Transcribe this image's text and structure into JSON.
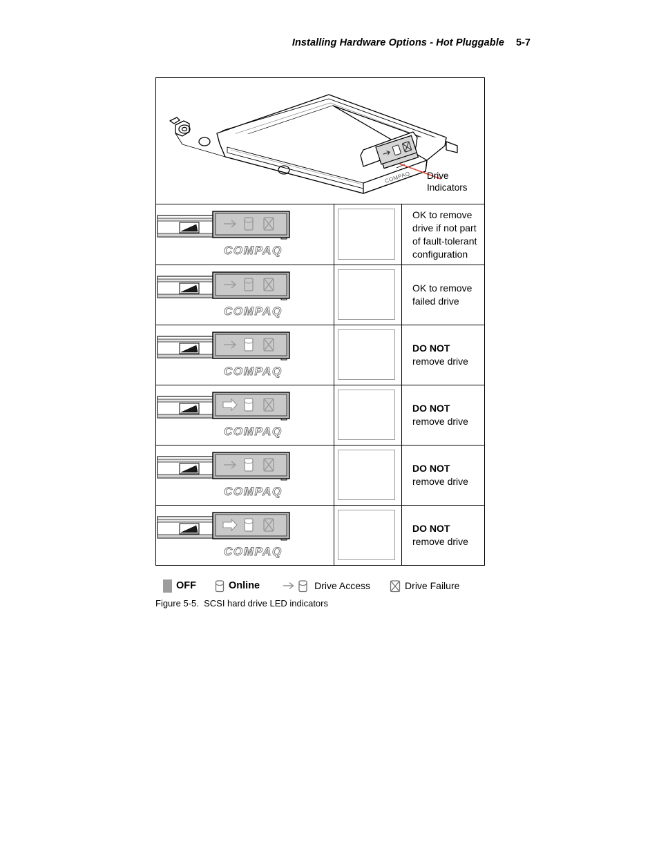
{
  "header": {
    "title": "Installing Hardware Options - Hot Pluggable",
    "page_number": "5-7"
  },
  "figure": {
    "callout_label": "Drive\nIndicators",
    "caption": "Figure 5-5.  SCSI hard drive LED indicators",
    "drive_logo": "COMPAQ"
  },
  "legend": {
    "items": [
      {
        "icon": "filled-square-icon",
        "label": "OFF",
        "bold": true
      },
      {
        "icon": "cylinder-icon",
        "label": "Online",
        "bold": true
      },
      {
        "icon": "arrow-cylinder-icon",
        "label": "Drive Access",
        "bold": false
      },
      {
        "icon": "crossed-box-icon",
        "label": "Drive Failure",
        "bold": false
      }
    ]
  },
  "table": {
    "rows": [
      {
        "index": 1,
        "leds": {
          "access": "off",
          "online": "off",
          "failure": "off"
        },
        "action_bold": "",
        "action_text": "OK to remove drive if not part of fault-tolerant configuration"
      },
      {
        "index": 2,
        "leds": {
          "access": "off",
          "online": "off",
          "failure": "off"
        },
        "action_bold": "",
        "action_text": "OK to remove failed drive"
      },
      {
        "index": 3,
        "leds": {
          "access": "off",
          "online": "on",
          "failure": "off"
        },
        "action_bold": "DO NOT",
        "action_text": " remove drive"
      },
      {
        "index": 4,
        "leds": {
          "access": "on",
          "online": "on",
          "failure": "off"
        },
        "action_bold": "DO NOT",
        "action_text": " remove drive"
      },
      {
        "index": 5,
        "leds": {
          "access": "off",
          "online": "on",
          "failure": "off"
        },
        "action_bold": "DO NOT",
        "action_text": " remove drive"
      },
      {
        "index": 6,
        "leds": {
          "access": "on",
          "online": "on",
          "failure": "off"
        },
        "action_bold": "DO NOT",
        "action_text": " remove drive"
      }
    ]
  },
  "colors": {
    "led_panel_bg": "#c9c9c9",
    "led_off": "#9d9d9d",
    "led_on": "#ffffff",
    "callout_line": "#e8483c",
    "ink": "#000000"
  }
}
